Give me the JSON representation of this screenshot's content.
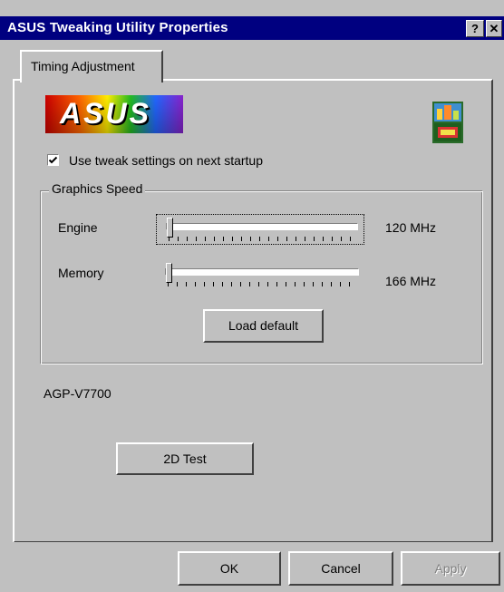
{
  "window": {
    "title": "ASUS Tweaking Utility Properties",
    "help_button": "?",
    "close_button": "✕"
  },
  "tabs": [
    {
      "label": "Timing Adjustment",
      "selected": true
    }
  ],
  "logo": {
    "text": "ASUS"
  },
  "startup_checkbox": {
    "label": "Use tweak settings on next startup",
    "checked": true
  },
  "graphics_speed": {
    "title": "Graphics Speed",
    "engine": {
      "label": "Engine",
      "value": "120 MHz",
      "level": 0.02
    },
    "memory": {
      "label": "Memory",
      "value": "166 MHz",
      "level": 0.0
    },
    "load_default_label": "Load default"
  },
  "model": "AGP-V7700",
  "test_button_label": "2D Test",
  "footer": {
    "ok_label": "OK",
    "cancel_label": "Cancel",
    "apply_label": "Apply"
  },
  "colors": {
    "titlebar": "#000080",
    "face": "#c0c0c0"
  }
}
